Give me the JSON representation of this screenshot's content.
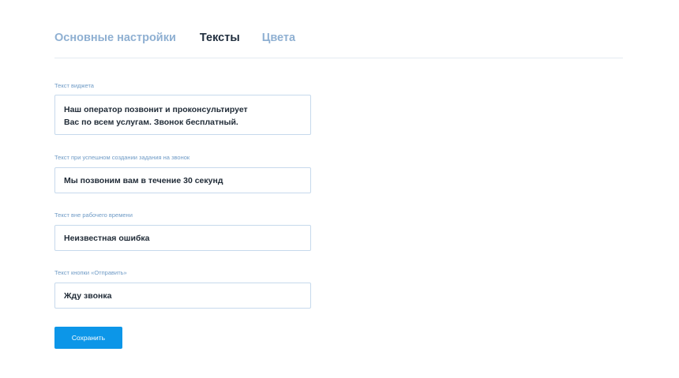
{
  "tabs": [
    {
      "label": "Основные настройки",
      "active": false
    },
    {
      "label": "Тексты",
      "active": true
    },
    {
      "label": "Цвета",
      "active": false
    }
  ],
  "fields": {
    "widget_text": {
      "label": "Текст  виджета",
      "lines": [
        "Наш оператор позвонит и проконсультирует",
        "Вас по всем услугам. Звонок бесплатный."
      ]
    },
    "success_text": {
      "label": "Текст при успешном создании задания на звонок",
      "value": "Мы позвоним вам в течение 30 секунд"
    },
    "offhours_text": {
      "label": "Текст вне рабочего времени",
      "value": "Неизвестная ошибка"
    },
    "submit_text": {
      "label": "Текст кнопки «Отправить»",
      "value": "Жду звонка"
    }
  },
  "save_button": {
    "label": "Сохранить"
  },
  "colors": {
    "accent": "#0c96e8",
    "tab_inactive": "#8fb0d2",
    "tab_active": "#1f2d3d",
    "label": "#6f9bc6",
    "field_border": "#c6d9ec"
  }
}
